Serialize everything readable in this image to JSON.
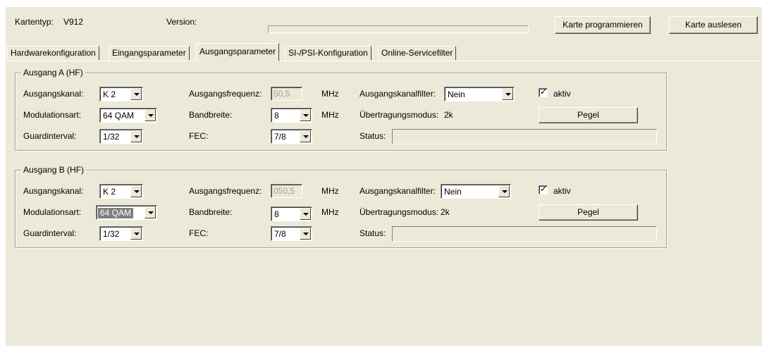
{
  "header": {
    "card_type_label": "Kartentyp:",
    "card_type_value": "V912",
    "version_label": "Version:",
    "progress_percent": 0,
    "program_button": "Karte programmieren",
    "read_button": "Karte auslesen"
  },
  "tabs": [
    {
      "label": "Hardwarekonfiguration",
      "active": false
    },
    {
      "label": "Eingangsparameter",
      "active": false
    },
    {
      "label": "Ausgangsparameter",
      "active": true
    },
    {
      "label": "SI-/PSI-Konfiguration",
      "active": false
    },
    {
      "label": "Online-Servicefilter",
      "active": false
    }
  ],
  "groups": [
    {
      "title": "Ausgang A (HF)",
      "channel_label": "Ausgangskanal:",
      "channel_value": "K 2",
      "frequency_label": "Ausgangsfrequenz:",
      "frequency_value": "50,5",
      "frequency_unit": "MHz",
      "filter_label": "Ausgangskanalfilter:",
      "filter_value": "Nein",
      "active_label": "aktiv",
      "active_checked": true,
      "modulation_label": "Modulationsart:",
      "modulation_value": "64 QAM",
      "bandwidth_label": "Bandbreite:",
      "bandwidth_value": "8",
      "bandwidth_unit": "MHz",
      "transmission_label": "Übertragungsmodus:",
      "transmission_value": "2k",
      "level_button": "Pegel",
      "guard_label": "Guardinterval:",
      "guard_value": "1/32",
      "fec_label": "FEC:",
      "fec_value": "7/8",
      "status_label": "Status:"
    },
    {
      "title": "Ausgang B (HF)",
      "channel_label": "Ausgangskanal:",
      "channel_value": "K 2",
      "frequency_label": "Ausgangsfrequenz:",
      "frequency_value": "050,5",
      "frequency_unit": "MHz",
      "filter_label": "Ausgangskanalfilter:",
      "filter_value": "Nein",
      "active_label": "aktiv",
      "active_checked": true,
      "modulation_label": "Modulationsart:",
      "modulation_value": "64 QAM",
      "bandwidth_label": "Bandbreite:",
      "bandwidth_value": "8",
      "bandwidth_unit": "MHz",
      "transmission_label": "Übertragungsmodus:",
      "transmission_value": "2k",
      "level_button": "Pegel",
      "guard_label": "Guardinterval:",
      "guard_value": "1/32",
      "fec_label": "FEC:",
      "fec_value": "7/8",
      "status_label": "Status:"
    }
  ],
  "colors": {
    "panel_bg": "#ece9d8",
    "selection_bg": "#808080",
    "progress_fill": "#3a6ea5"
  }
}
